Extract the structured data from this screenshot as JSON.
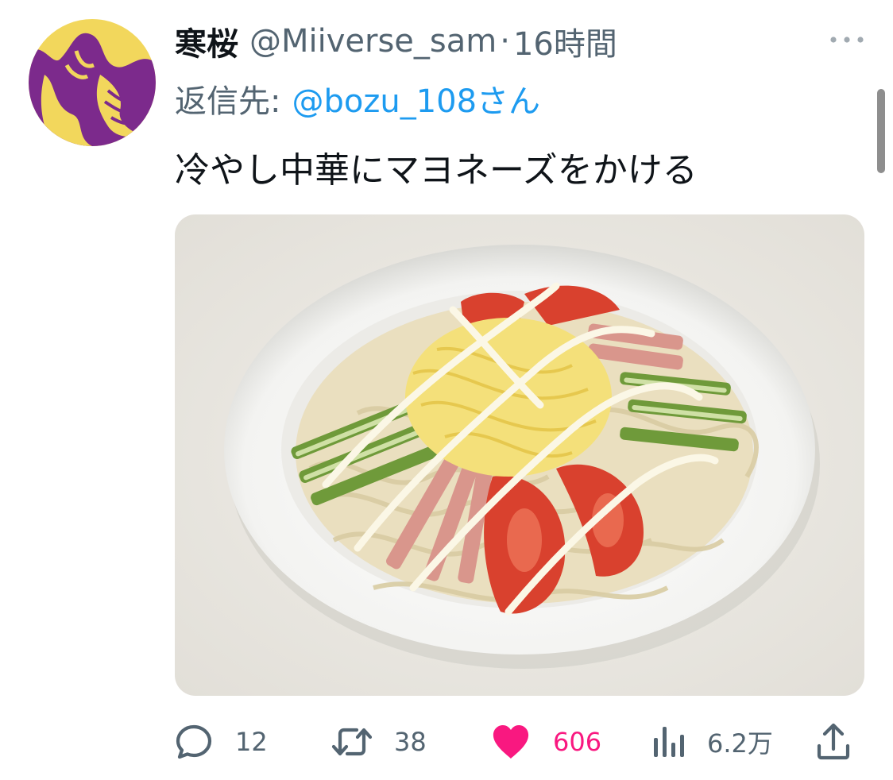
{
  "tweet": {
    "display_name": "寒桜",
    "handle": "@Miiverse_sam",
    "separator": "·",
    "time": "16時間",
    "reply_prefix": "返信先:",
    "reply_target": "@bozu_108さん",
    "text": "冷やし中華にマヨネーズをかける"
  },
  "actions": {
    "reply_count": "12",
    "retweet_count": "38",
    "like_count": "606",
    "views_count": "6.2万"
  },
  "icons": {
    "avatar": "avatar-illustration",
    "more": "more-icon",
    "reply": "reply-icon",
    "retweet": "retweet-icon",
    "like": "heart-icon",
    "views": "views-icon",
    "share": "share-icon"
  },
  "colors": {
    "text": "#0f1419",
    "muted": "#536471",
    "link": "#1d9bf0",
    "like": "#f91880",
    "avatar_bg": "#f2d75c",
    "avatar_fg": "#7c2a8c"
  }
}
